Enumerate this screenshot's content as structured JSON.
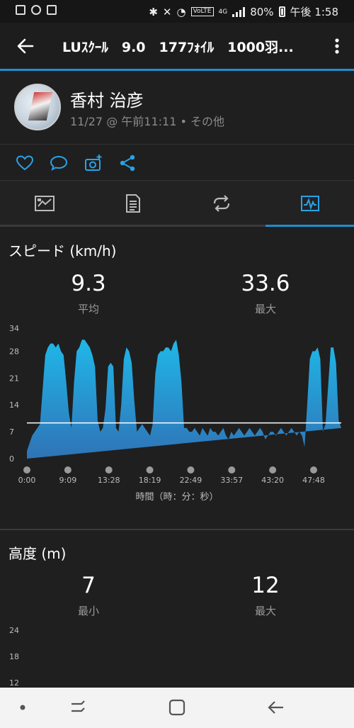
{
  "status_bar": {
    "battery": "80%",
    "time": "午後 1:58",
    "network": "4G"
  },
  "app_bar": {
    "title": "LUｽｸｰﾙ　9.0　177ﾌｫｲﾙ　1000羽..."
  },
  "profile": {
    "name": "香村 治彦",
    "subtitle": "11/27 @ 午前11:11 • その他"
  },
  "tabs": [
    "summary",
    "details",
    "laps",
    "charts"
  ],
  "speed": {
    "title": "スピード (km/h)",
    "avg_value": "9.3",
    "avg_label": "平均",
    "max_value": "33.6",
    "max_label": "最大",
    "x_axis_title": "時間（時：分：秒）"
  },
  "altitude": {
    "title": "高度 (m)",
    "min_value": "7",
    "min_label": "最小",
    "max_value": "12",
    "max_label": "最大"
  },
  "chart_data": [
    {
      "type": "area",
      "ylabel": "",
      "xlabel": "時間（時：分：秒）",
      "ylim": [
        0,
        34
      ],
      "y_ticks": [
        "34",
        "28",
        "21",
        "14",
        "7",
        "0"
      ],
      "x_ticks": [
        "0:00",
        "9:09",
        "13:28",
        "18:19",
        "22:49",
        "33:57",
        "43:20",
        "47:48"
      ],
      "average_line": 9.3,
      "colors": {
        "fill_top": "#20b7e8",
        "fill_bottom": "#2f73b6",
        "avg_line": "#ffffff"
      },
      "x": [
        0,
        1,
        2,
        3,
        4,
        5,
        6,
        7,
        8,
        9,
        10,
        11,
        12,
        13,
        14,
        15,
        16,
        17,
        18,
        19,
        20,
        21,
        22,
        23,
        24,
        25,
        26,
        27,
        28,
        29,
        30,
        31,
        32,
        33,
        34,
        35,
        36,
        37,
        38,
        39,
        40,
        41,
        42,
        43,
        44,
        45,
        46,
        47,
        48,
        49,
        50,
        51,
        52,
        53,
        54,
        55,
        56,
        57,
        58,
        59,
        60,
        61,
        62,
        63,
        64,
        65,
        66,
        67,
        68,
        69,
        70,
        71,
        72,
        73,
        74,
        75,
        76,
        77,
        78,
        79,
        80,
        81,
        82,
        83,
        84,
        85,
        86,
        87,
        88,
        89,
        90,
        91,
        92,
        93,
        94,
        95,
        96,
        97,
        98,
        99,
        100,
        101,
        102,
        103,
        104,
        105,
        106,
        107,
        108,
        109,
        110,
        111,
        112,
        113,
        114,
        115,
        116,
        117,
        118,
        119,
        120
      ],
      "values": [
        2,
        4,
        6,
        7,
        8,
        9,
        18,
        27,
        29,
        30,
        30,
        29,
        30,
        28,
        27,
        20,
        12,
        8,
        20,
        28,
        29,
        31,
        31,
        30,
        29,
        27,
        24,
        10,
        7,
        8,
        13,
        24,
        25,
        24,
        8,
        7,
        14,
        26,
        29,
        28,
        25,
        15,
        7,
        8,
        9,
        8,
        7,
        6,
        9,
        22,
        27,
        28,
        28,
        29,
        29,
        28,
        30,
        31,
        27,
        20,
        8,
        8,
        7,
        7,
        8,
        7,
        6,
        8,
        7,
        6,
        8,
        7,
        7,
        6,
        7,
        8,
        6,
        5,
        7,
        6,
        7,
        8,
        7,
        6,
        7,
        8,
        7,
        6,
        7,
        8,
        7,
        5,
        6,
        7,
        7,
        6,
        7,
        8,
        7,
        6,
        7,
        8,
        7,
        6,
        7,
        6,
        3,
        14,
        26,
        28,
        28,
        29,
        26,
        7,
        9,
        19,
        29,
        29,
        25,
        10,
        8,
        8,
        9,
        8,
        7,
        7,
        8,
        7,
        6,
        7,
        8,
        7,
        6,
        6
      ]
    },
    {
      "type": "area",
      "ylabel": "",
      "ylim": [
        12,
        24
      ],
      "y_ticks": [
        "24",
        "18",
        "12"
      ],
      "values": []
    }
  ]
}
